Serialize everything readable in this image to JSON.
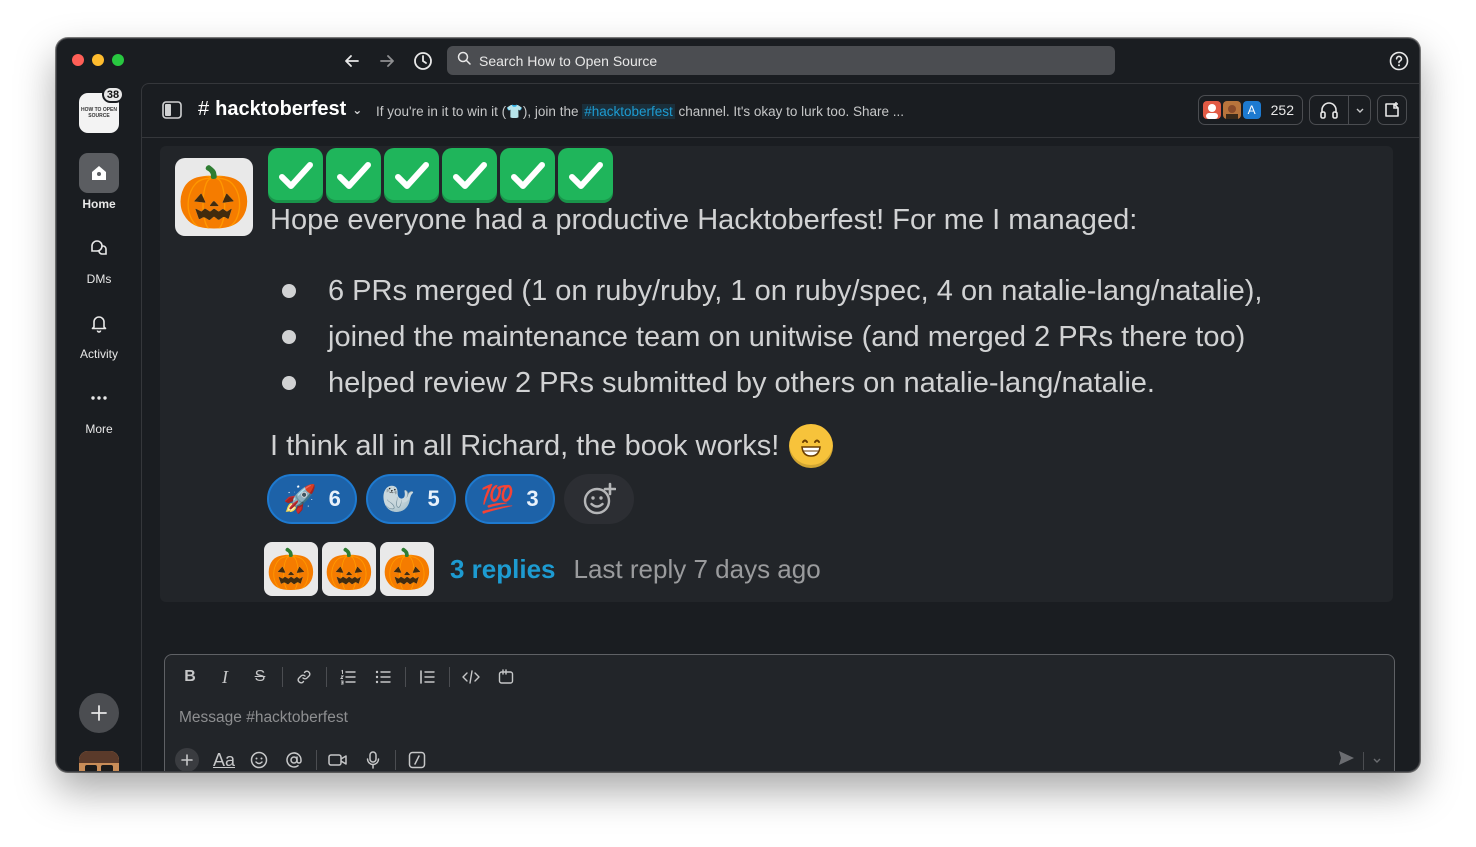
{
  "window": {
    "search_placeholder": "Search How to Open Source"
  },
  "workspace": {
    "badge_count": "38",
    "logo_text": "HOW TO OPEN SOURCE"
  },
  "sidebar": {
    "items": [
      {
        "label": "Home",
        "icon": "home-icon"
      },
      {
        "label": "DMs",
        "icon": "dms-icon"
      },
      {
        "label": "Activity",
        "icon": "bell-icon"
      },
      {
        "label": "More",
        "icon": "more-icon"
      }
    ]
  },
  "channel": {
    "name": "hacktoberfest",
    "hash": "#",
    "topic_before": "If you're in it to win it (👕), join the ",
    "topic_link": "#hacktoberfest",
    "topic_after": " channel. It's okay to lurk too. Share ...",
    "member_count": "252"
  },
  "message": {
    "avatar": "🎃",
    "headline": "Hope everyone had a productive Hacktoberfest! For me I managed:",
    "bullets": [
      "6 PRs merged (1 on ruby/ruby, 1 on ruby/spec, 4 on natalie-lang/natalie),",
      "joined the maintenance team on unitwise (and merged 2 PRs there too)",
      "helped review 2 PRs submitted by others on natalie-lang/natalie."
    ],
    "closing": "I think all in all Richard, the book works!",
    "closing_emoji": "😁",
    "reactions": [
      {
        "emoji": "🚀",
        "count": "6"
      },
      {
        "emoji": "🦭",
        "count": "5"
      },
      {
        "emoji": "💯",
        "count": "3"
      }
    ],
    "thread": {
      "avatars": [
        "🎃",
        "🎃",
        "🎃"
      ],
      "replies": "3 replies",
      "last_reply": "Last reply 7 days ago"
    }
  },
  "composer": {
    "placeholder": "Message #hacktoberfest",
    "format_font_label": "Aa"
  },
  "colors": {
    "background": "#1a1d21",
    "message_bg": "#222529",
    "link": "#1d9bd1",
    "reaction_bg": "#1d62a8",
    "check_green": "#1fb55b"
  }
}
